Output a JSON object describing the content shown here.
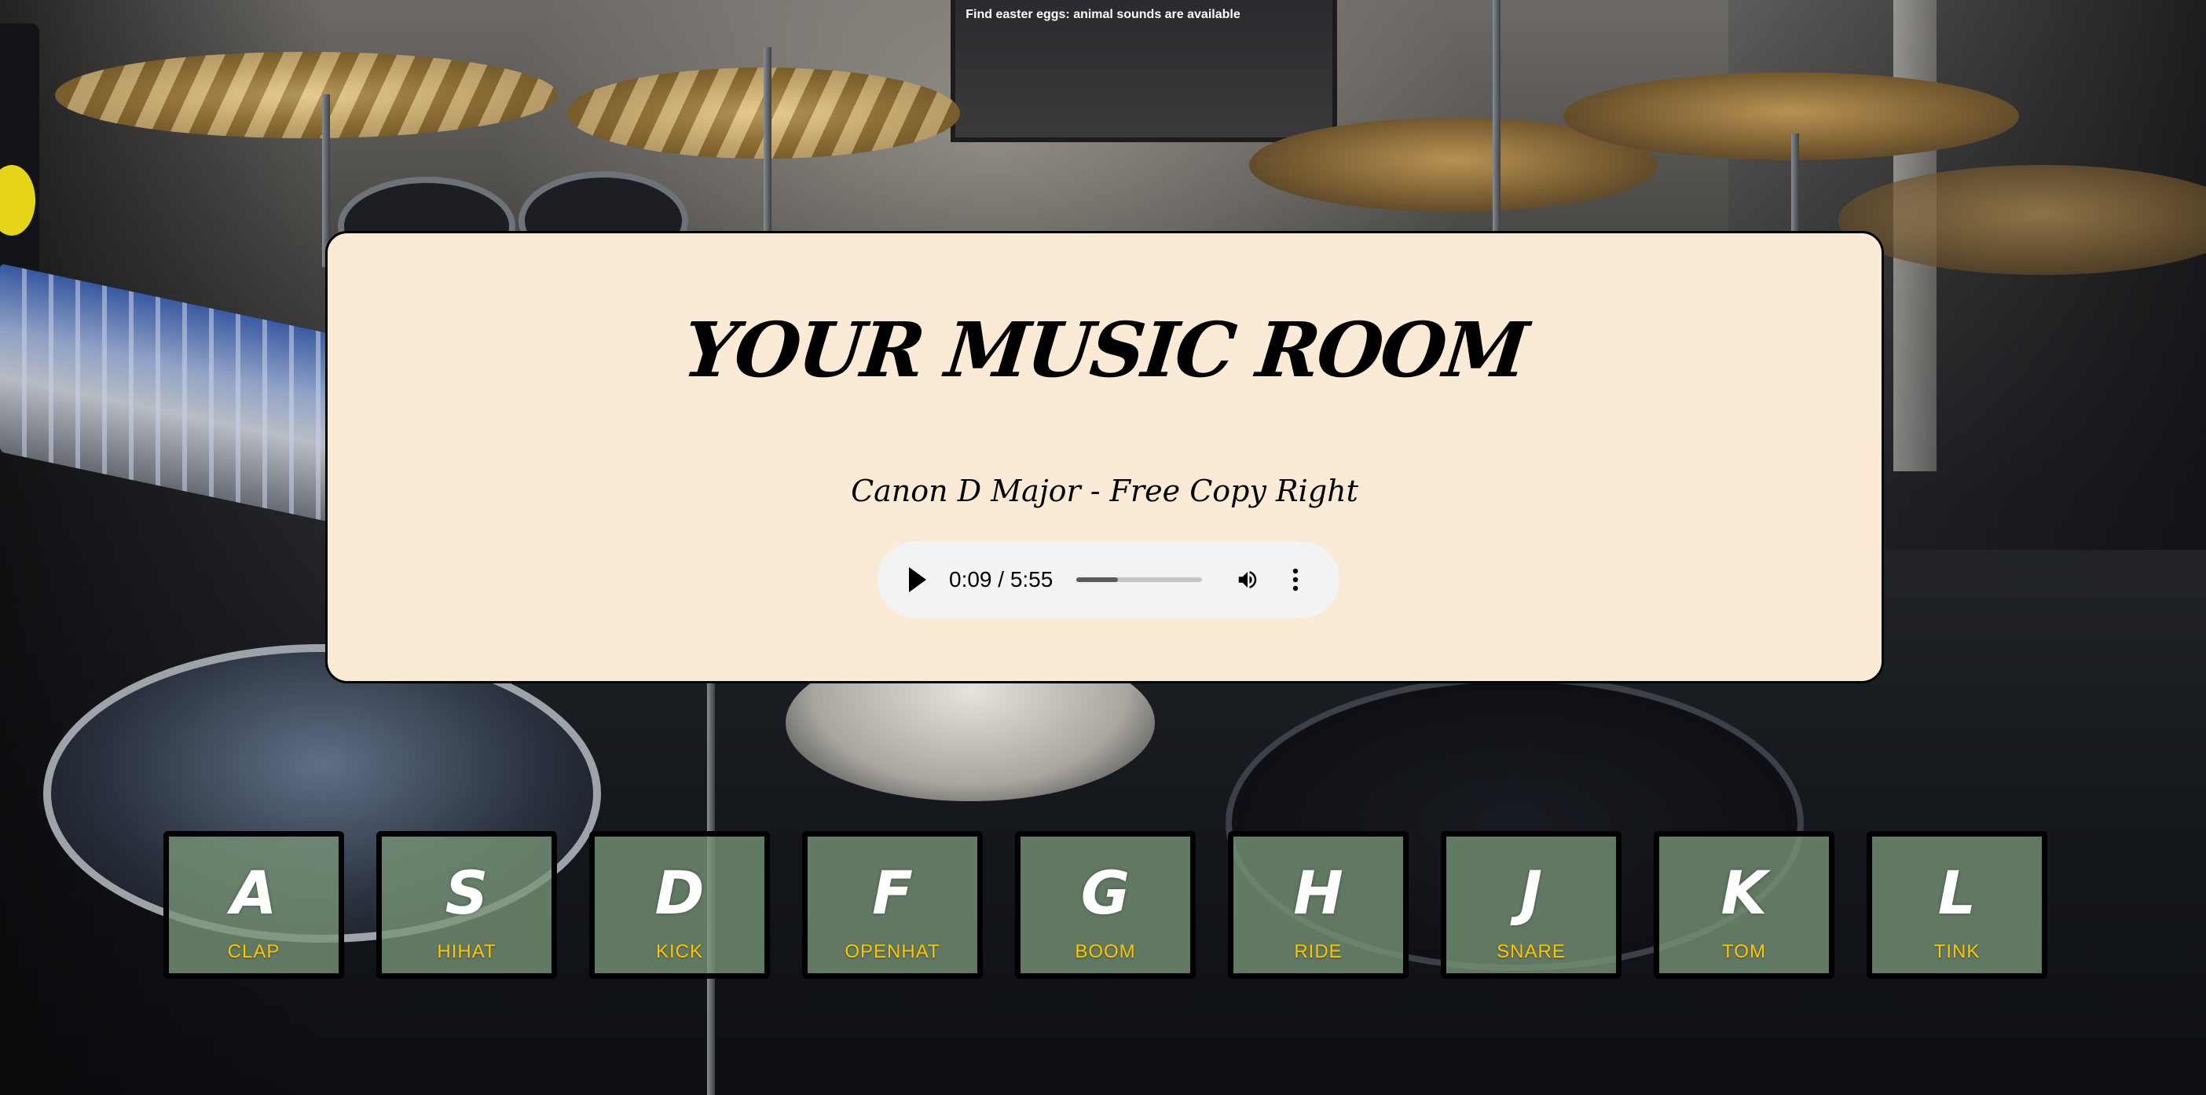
{
  "hint": "Find easter eggs: animal sounds are available",
  "title": "YOUR MUSIC ROOM",
  "song": "Canon D Major - Free Copy Right",
  "player": {
    "time": "0:09 / 5:55",
    "progress": 0.33
  },
  "keys": [
    {
      "letter": "A",
      "sound": "CLAP"
    },
    {
      "letter": "S",
      "sound": "HIHAT"
    },
    {
      "letter": "D",
      "sound": "KICK"
    },
    {
      "letter": "F",
      "sound": "OPENHAT"
    },
    {
      "letter": "G",
      "sound": "BOOM"
    },
    {
      "letter": "H",
      "sound": "RIDE"
    },
    {
      "letter": "J",
      "sound": "SNARE"
    },
    {
      "letter": "K",
      "sound": "TOM"
    },
    {
      "letter": "L",
      "sound": "TINK"
    }
  ],
  "colors": {
    "panel": "#fbead6",
    "key_letter": "#ffffff",
    "key_sound": "#ffc600",
    "key_bg": "#789678"
  }
}
